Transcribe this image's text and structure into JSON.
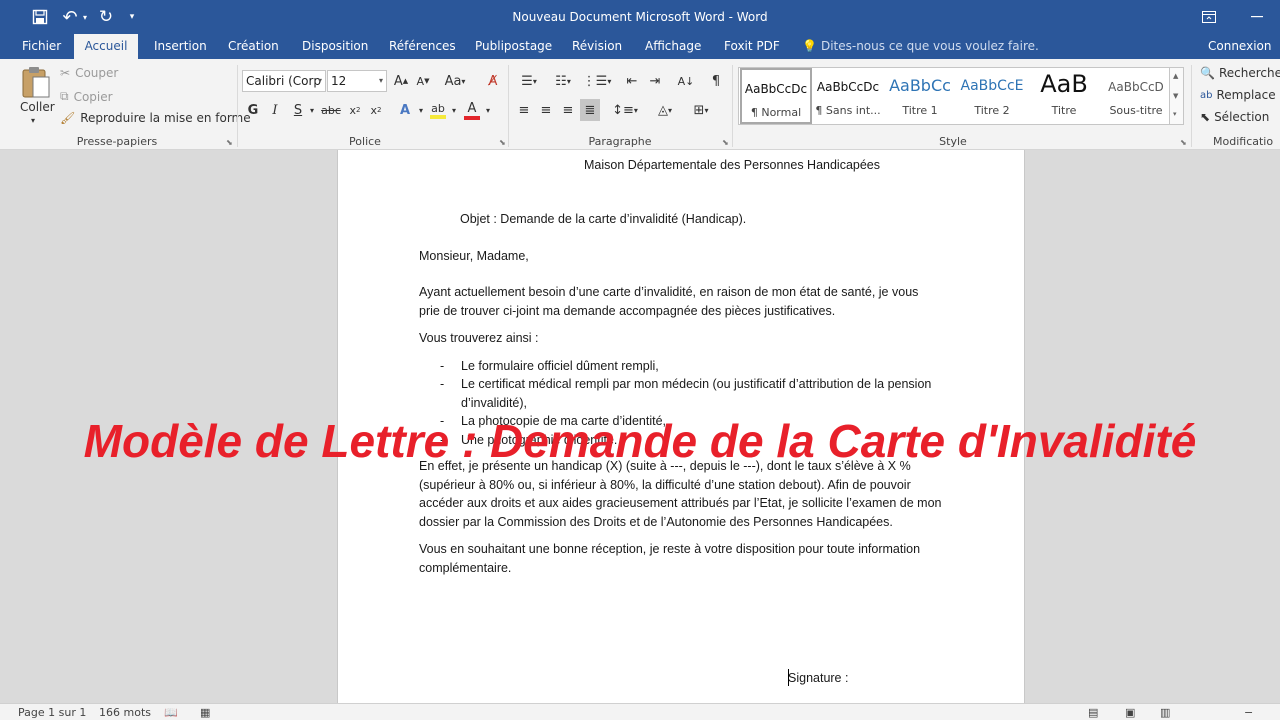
{
  "window": {
    "title": "Nouveau Document Microsoft Word - Word",
    "icons": [
      "save-icon",
      "undo-icon",
      "redo-icon",
      "customize-icon",
      "ribbon-display-icon",
      "minimize-icon"
    ]
  },
  "tabs": {
    "fichier": "Fichier",
    "accueil": "Accueil",
    "insertion": "Insertion",
    "creation": "Création",
    "disposition": "Disposition",
    "references": "Références",
    "publipostage": "Publipostage",
    "revision": "Révision",
    "affichage": "Affichage",
    "foxit": "Foxit PDF",
    "tellme": "Dites-nous ce que vous voulez faire.",
    "connexion": "Connexion"
  },
  "ribbon": {
    "clipboard": {
      "paste": "Coller",
      "cut": "Couper",
      "copy": "Copier",
      "format_painter": "Reproduire la mise en forme",
      "label": "Presse-papiers"
    },
    "font": {
      "family": "Calibri (Corp",
      "size": "12",
      "label": "Police",
      "font_color": "#e3262b",
      "highlight_color": "#f5e93b"
    },
    "paragraph": {
      "label": "Paragraphe"
    },
    "styles": {
      "label": "Style",
      "items": [
        {
          "preview": "AaBbCcDc",
          "name": "¶ Normal"
        },
        {
          "preview": "AaBbCcDc",
          "name": "¶ Sans int..."
        },
        {
          "preview": "AaBbCc",
          "name": "Titre 1"
        },
        {
          "preview": "AaBbCcE",
          "name": "Titre 2"
        },
        {
          "preview": "AaB",
          "name": "Titre"
        },
        {
          "preview": "AaBbCcD",
          "name": "Sous-titre"
        }
      ],
      "heading_color": "#2e74b5"
    },
    "editing": {
      "find": "Recherche",
      "replace": "Remplace",
      "select": "Sélection",
      "label": "Modificatio"
    }
  },
  "document": {
    "recipient": "Maison Départementale des Personnes Handicapées",
    "subject": "Objet : Demande de la carte d’invalidité (Handicap).",
    "salutation": "Monsieur, Madame,",
    "p1_l1": "Ayant actuellement besoin d’une carte d’invalidité, en raison de mon état de santé, je vous",
    "p1_l2": "prie de trouver ci-joint ma demande accompagnée des pièces justificatives.",
    "p2": "Vous trouverez ainsi :",
    "list": {
      "item1": "Le formulaire officiel dûment rempli,",
      "item2_l1": "Le certificat médical rempli par mon médecin (ou justificatif d’attribution de la pension",
      "item2_l2": "d’invalidité),",
      "item3": "La photocopie de ma carte d’identité,",
      "item4": "Une photographie d’identité."
    },
    "p3_l1": "En effet, je présente un handicap (X) (suite à ---, depuis le ---), dont le taux s’élève à X %",
    "p3_l2": "(supérieur à 80% ou, si inférieur à 80%, la difficulté d’une station debout). Afin de pouvoir",
    "p3_l3": "accéder aux droits et aux aides gracieusement attribués par l’Etat, je sollicite l’examen de mon",
    "p3_l4": "dossier par la Commission des Droits et de l’Autonomie des Personnes Handicapées.",
    "p4_l1": "Vous en souhaitant une bonne réception, je reste à votre disposition pour toute information",
    "p4_l2": "complémentaire.",
    "signature": "Signature :"
  },
  "overlay": {
    "title": "Modèle de Lettre : Demande de la Carte d'Invalidité",
    "color": "#e8202a"
  },
  "statusbar": {
    "page": "Page 1 sur 1",
    "words": "166 mots"
  }
}
